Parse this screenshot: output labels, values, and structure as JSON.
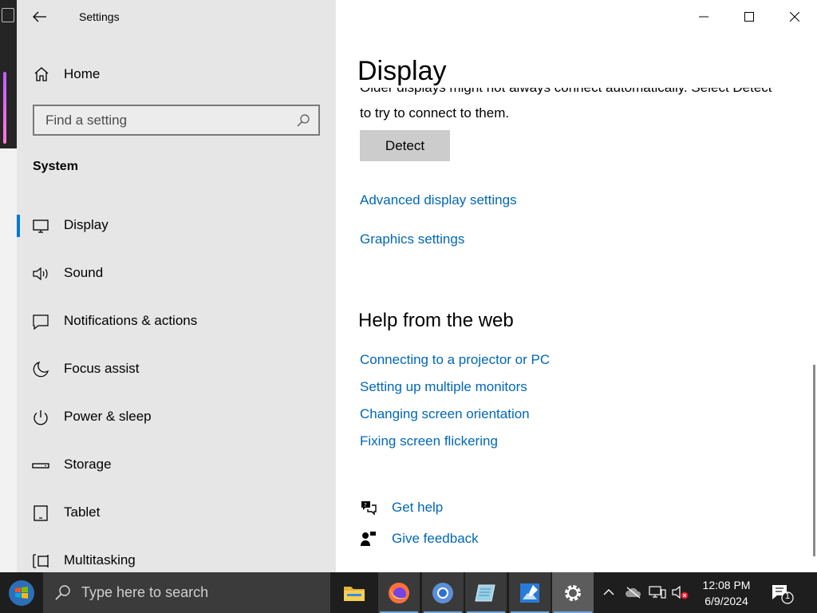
{
  "window": {
    "title": "Settings"
  },
  "sidebar": {
    "home_label": "Home",
    "search_placeholder": "Find a setting",
    "section": "System",
    "items": [
      {
        "label": "Display",
        "icon": "monitor-icon",
        "selected": true
      },
      {
        "label": "Sound",
        "icon": "speaker-icon"
      },
      {
        "label": "Notifications & actions",
        "icon": "message-icon"
      },
      {
        "label": "Focus assist",
        "icon": "moon-icon"
      },
      {
        "label": "Power & sleep",
        "icon": "power-icon"
      },
      {
        "label": "Storage",
        "icon": "drive-icon"
      },
      {
        "label": "Tablet",
        "icon": "tablet-icon"
      },
      {
        "label": "Multitasking",
        "icon": "multitasking-icon"
      }
    ]
  },
  "main": {
    "title": "Display",
    "clipped_text": "Older displays might not always connect automatically. Select Detect",
    "detect_description": "to try to connect to them.",
    "detect_button": "Detect",
    "links": [
      "Advanced display settings",
      "Graphics settings"
    ],
    "help_title": "Help from the web",
    "help_links": [
      "Connecting to a projector or PC",
      "Setting up multiple monitors",
      "Changing screen orientation",
      "Fixing screen flickering"
    ],
    "get_help": "Get help",
    "give_feedback": "Give feedback"
  },
  "taskbar": {
    "search_placeholder": "Type here to search",
    "apps": [
      "file-explorer-icon",
      "firefox-icon",
      "chromium-icon",
      "notepad-icon",
      "paint-icon",
      "settings-icon"
    ],
    "time": "12:08 PM",
    "date": "6/9/2024",
    "notification_count": "1"
  },
  "colors": {
    "accent": "#0078d7",
    "link": "#0067b8",
    "sidebar_bg": "#e6e6e6",
    "taskbar_bg": "#1e1e1e"
  }
}
